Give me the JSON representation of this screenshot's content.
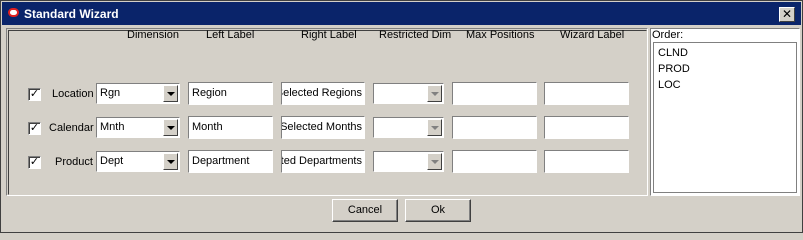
{
  "window": {
    "title": "Standard Wizard",
    "close_glyph": "✕"
  },
  "columns": {
    "dimension": "Dimension",
    "left_label": "Left Label",
    "right_label": "Right Label",
    "restricted_dim": "Restricted Dim",
    "max_positions": "Max Positions",
    "wizard_label": "Wizard Label"
  },
  "rows": [
    {
      "checked": "✓",
      "name": "Location",
      "dimension": "Rgn",
      "left_label": "Region",
      "right_label": "Selected Regions",
      "restricted_dim": "",
      "max_positions": "",
      "wizard_label": ""
    },
    {
      "checked": "✓",
      "name": "Calendar",
      "dimension": "Mnth",
      "left_label": "Month",
      "right_label": "Selected Months",
      "restricted_dim": "",
      "max_positions": "",
      "wizard_label": ""
    },
    {
      "checked": "✓",
      "name": "Product",
      "dimension": "Dept",
      "left_label": "Department",
      "right_label": "ted Departments",
      "restricted_dim": "",
      "max_positions": "",
      "wizard_label": ""
    }
  ],
  "order": {
    "label": "Order:",
    "items": [
      "CLND",
      "PROD",
      "LOC"
    ]
  },
  "buttons": {
    "cancel": "Cancel",
    "ok": "Ok"
  }
}
